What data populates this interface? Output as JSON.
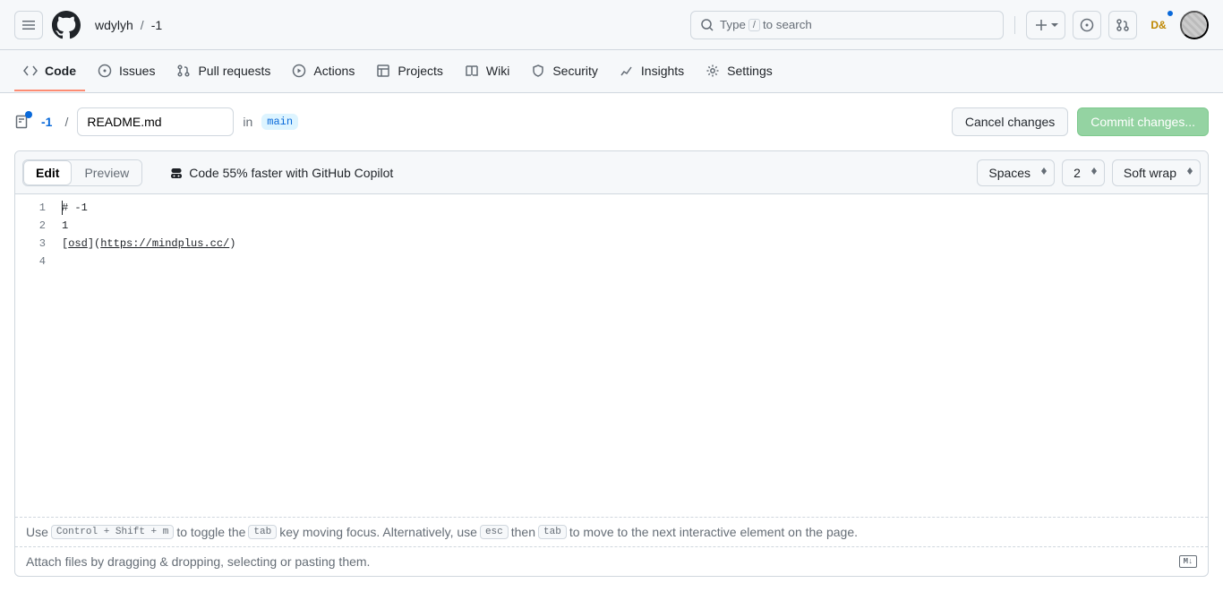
{
  "header": {
    "owner": "wdylyh",
    "repo": "-1",
    "search_prefix": "Type ",
    "search_key": "/",
    "search_suffix": " to search"
  },
  "tabs": {
    "code": "Code",
    "issues": "Issues",
    "pull_requests": "Pull requests",
    "actions": "Actions",
    "projects": "Projects",
    "wiki": "Wiki",
    "security": "Security",
    "insights": "Insights",
    "settings": "Settings"
  },
  "toolbar": {
    "repo_link": "-1",
    "slash": "/",
    "filename": "README.md",
    "in_word": "in",
    "branch": "main",
    "cancel": "Cancel changes",
    "commit": "Commit changes..."
  },
  "editor_header": {
    "edit": "Edit",
    "preview": "Preview",
    "copilot": "Code 55% faster with GitHub Copilot",
    "indent_mode": "Spaces",
    "indent_size": "2",
    "wrap": "Soft wrap"
  },
  "code": {
    "gutter": [
      "1",
      "2",
      "3",
      "4"
    ],
    "line1": "# -1",
    "line2": "1",
    "line3_prefix": "[",
    "line3_text": "osd",
    "line3_mid": "](",
    "line3_url": "https://mindplus.cc/",
    "line3_suffix": ")"
  },
  "footer": {
    "hint_1": "Use ",
    "kbd1": "Control + Shift + m",
    "hint_2": " to toggle the ",
    "kbd2": "tab",
    "hint_3": " key moving focus. Alternatively, use ",
    "kbd3": "esc",
    "hint_4": " then ",
    "kbd4": "tab",
    "hint_5": " to move to the next interactive element on the page.",
    "attach": "Attach files by dragging & dropping, selecting or pasting them.",
    "md_label": "M↓"
  }
}
